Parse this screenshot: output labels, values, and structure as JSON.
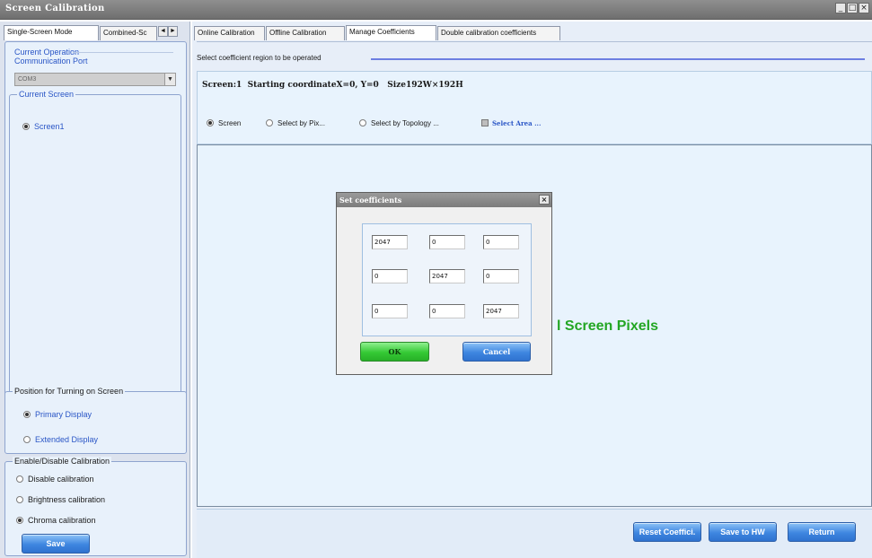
{
  "window": {
    "title": "Screen Calibration",
    "controls": [
      "_",
      "□",
      "×"
    ]
  },
  "left_tabs": [
    {
      "label": "Single-Screen Mode"
    },
    {
      "label": "Combined-Sc"
    }
  ],
  "tab_scroll": {
    "left": "◄",
    "right": "►"
  },
  "current_operation": {
    "legend": "Current Operation",
    "port_label": "Communication Port",
    "port_value": "COM3"
  },
  "current_screen": {
    "legend": "Current Screen",
    "items": [
      "Screen1"
    ],
    "selected": 0
  },
  "position_group": {
    "legend": "Position for Turning on Screen",
    "options": [
      "Primary Display",
      "Extended Display"
    ],
    "selected": 0
  },
  "calibration_group": {
    "legend": "Enable/Disable Calibration",
    "options": [
      "Disable calibration",
      "Brightness calibration",
      "Chroma calibration"
    ],
    "selected": 2,
    "save_label": "Save"
  },
  "right_tabs": [
    {
      "label": "Online Calibration"
    },
    {
      "label": "Offline Calibration"
    },
    {
      "label": "Manage Coefficients"
    },
    {
      "label": "Double calibration coefficients"
    }
  ],
  "active_right_tab": 2,
  "region_prompt": "Select coefficient region to be operated",
  "screen_info": "Screen:1  Starting coordinateX=0, Y=0   Size192W×192H",
  "region_options": {
    "screen": "Screen",
    "by_pixel": "Select by Pix...",
    "by_topology": "Select by Topology ...",
    "select_area": "Select Area ...",
    "selected": "screen"
  },
  "canvas_text": "l Screen Pixels",
  "dialog": {
    "title": "Set coefficients",
    "close": "×",
    "matrix": [
      [
        "2047",
        "0",
        "0"
      ],
      [
        "0",
        "2047",
        "0"
      ],
      [
        "0",
        "0",
        "2047"
      ]
    ],
    "ok_label": "OK",
    "cancel_label": "Cancel"
  },
  "bottom_buttons": {
    "reset": "Reset Coeffici.",
    "save_hw": "Save to HW",
    "return": "Return"
  }
}
